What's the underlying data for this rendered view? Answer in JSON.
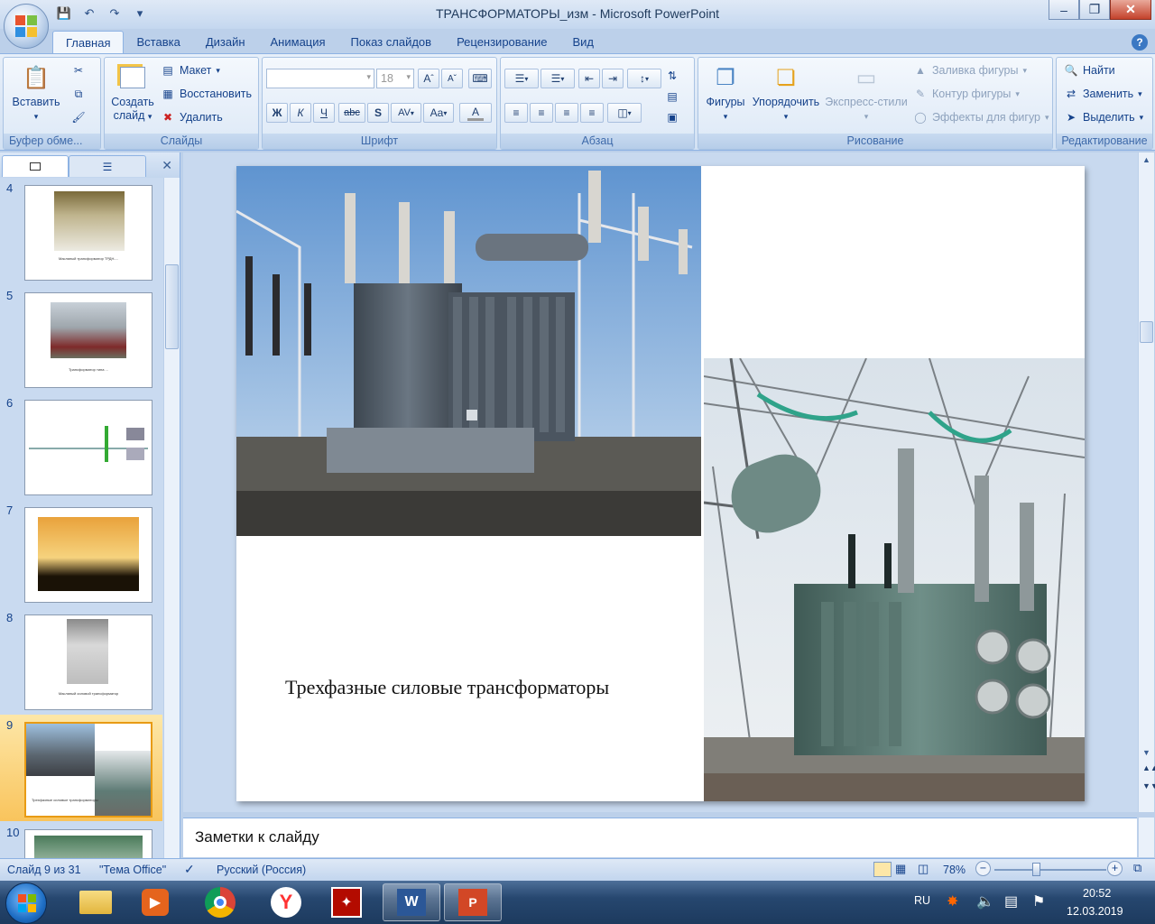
{
  "window": {
    "title": "ТРАНСФОРМАТОРЫ_изм - Microsoft PowerPoint"
  },
  "ribbon_tabs": [
    "Главная",
    "Вставка",
    "Дизайн",
    "Анимация",
    "Показ слайдов",
    "Рецензирование",
    "Вид"
  ],
  "clipboard": {
    "paste": "Вставить",
    "label": "Буфер обме..."
  },
  "slides_group": {
    "new_slide_1": "Создать",
    "new_slide_2": "слайд",
    "layout": "Макет",
    "reset": "Восстановить",
    "delete": "Удалить",
    "label": "Слайды"
  },
  "font_group": {
    "font_name": "",
    "font_size": "18",
    "bold": "Ж",
    "italic": "К",
    "underline": "Ч",
    "strike": "abc",
    "shadow": "S",
    "spacing": "AV",
    "case": "Aa",
    "color": "A",
    "grow": "A",
    "shrink": "A",
    "label": "Шрифт"
  },
  "paragraph_group": {
    "label": "Абзац"
  },
  "drawing_group": {
    "shapes": "Фигуры",
    "arrange": "Упорядочить",
    "quick_styles": "Экспресс-стили",
    "fill": "Заливка фигуры",
    "outline": "Контур фигуры",
    "effects": "Эффекты для фигур",
    "label": "Рисование"
  },
  "editing_group": {
    "find": "Найти",
    "replace": "Заменить",
    "select": "Выделить",
    "label": "Редактирование"
  },
  "thumbnails": [
    {
      "num": "4",
      "caption": "Масляный трансформатор ТРДН-..."
    },
    {
      "num": "5",
      "caption": "Трансформатор типа ..."
    },
    {
      "num": "6",
      "caption": ""
    },
    {
      "num": "7",
      "caption": ""
    },
    {
      "num": "8",
      "caption": "Масляный силовой трансформатор"
    },
    {
      "num": "9",
      "caption": "Трехфазные силовые трансформаторы"
    },
    {
      "num": "10",
      "caption": ""
    }
  ],
  "slide": {
    "caption": "Трехфазные силовые трансформаторы"
  },
  "notes": {
    "placeholder": "Заметки к слайду"
  },
  "status": {
    "slide_counter": "Слайд 9 из 31",
    "theme": "\"Тема Office\"",
    "language": "Русский (Россия)",
    "zoom": "78%"
  },
  "taskbar": {
    "lang": "RU",
    "time": "20:52",
    "date": "12.03.2019"
  },
  "colors": {
    "ribbon": "#dbe7f6",
    "selected_thumb": "#f9c45c",
    "taskbar": "#26476f"
  }
}
